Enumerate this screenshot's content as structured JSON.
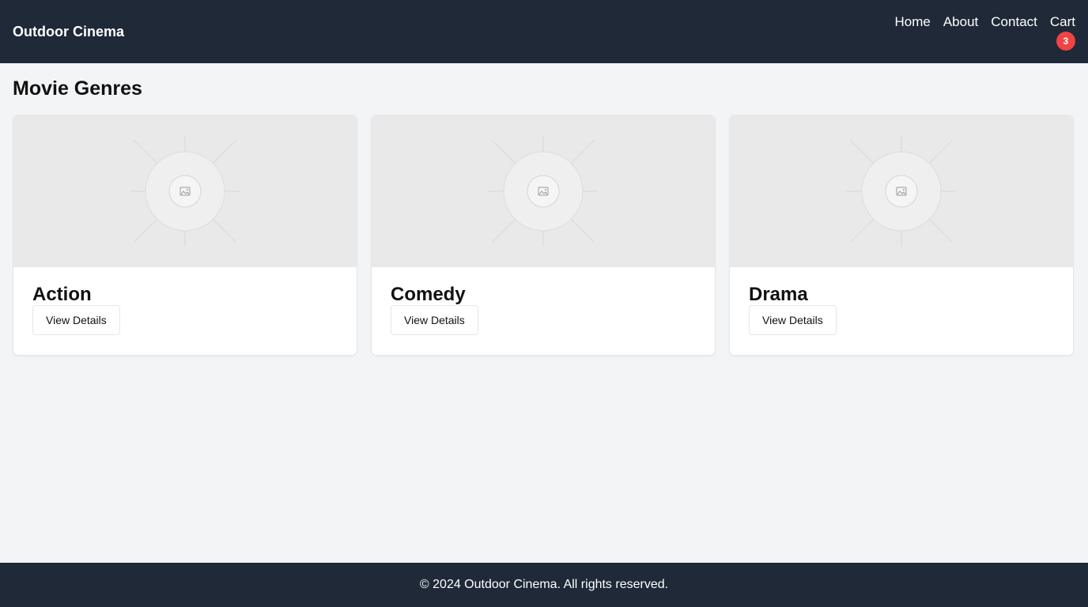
{
  "header": {
    "brand": "Outdoor Cinema",
    "nav": [
      "Home",
      "About",
      "Contact",
      "Cart"
    ],
    "cart_count": "3"
  },
  "main": {
    "title": "Movie Genres",
    "cards": [
      {
        "title": "Action",
        "button": "View Details",
        "image_icon": "image-placeholder-icon"
      },
      {
        "title": "Comedy",
        "button": "View Details",
        "image_icon": "image-placeholder-icon"
      },
      {
        "title": "Drama",
        "button": "View Details",
        "image_icon": "image-placeholder-icon"
      }
    ]
  },
  "footer": {
    "text": "© 2024 Outdoor Cinema. All rights reserved."
  },
  "colors": {
    "header_bg": "#1f2937",
    "page_bg": "#f3f4f6",
    "badge": "#ef4444"
  }
}
